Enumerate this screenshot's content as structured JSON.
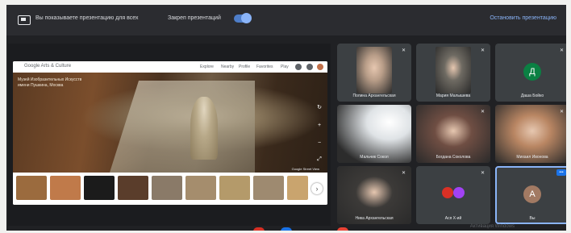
{
  "topbar": {
    "present_text": "Вы показываете презентацию для всех",
    "pinned_label": "Закреп презентаций",
    "stop_label": "Остановить презентацию"
  },
  "presentation": {
    "logo_text": "Google Arts & Culture",
    "tabs": [
      "Explore",
      "Nearby",
      "Profile",
      "Favorites",
      "Play"
    ],
    "caption": "Музей Изобразительных Искусств имени Пушкина, Москва",
    "credit": "Google Street View",
    "colors": {
      "thumbs": [
        "#9b6b3e",
        "#c07a4a",
        "#1b1b1b",
        "#5a3d2b",
        "#8a7a68",
        "#a58d6d",
        "#b49a6a",
        "#9e8a70",
        "#c9a46e"
      ]
    }
  },
  "participants": [
    {
      "name": "Полина Архангельская",
      "muted": true,
      "kind": "photo",
      "photo_color": "#b89d88"
    },
    {
      "name": "Мария Малышева",
      "muted": true,
      "kind": "photo",
      "photo_color": "#6e6a62"
    },
    {
      "name": "Даша Бойко",
      "muted": true,
      "kind": "avatar",
      "initial": "Д",
      "avatar_color": "#0b8043"
    },
    {
      "name": "Мальчик Сокол",
      "muted": true,
      "kind": "photo",
      "photo_color": "#e9ebe9"
    },
    {
      "name": "Богдана Соколова",
      "muted": true,
      "kind": "photo",
      "photo_color": "#6f4e43"
    },
    {
      "name": "Михаил Ивонова",
      "muted": true,
      "kind": "photo",
      "photo_color": "#b98663"
    },
    {
      "name": "Ника Архангельская",
      "muted": true,
      "kind": "photo",
      "photo_color": "#3c3a38"
    },
    {
      "name": "Ася Х-ий",
      "muted": true,
      "kind": "dual",
      "colors": [
        "#d93025",
        "#a142f4"
      ]
    },
    {
      "name": "Вы",
      "muted": false,
      "kind": "avatar",
      "initial": "А",
      "avatar_color": "#a27a63"
    }
  ],
  "watermark": "Активация Windows",
  "bottom_controls": {
    "colors": [
      "#d93025",
      "#1a73e8",
      "#ea4335"
    ]
  }
}
